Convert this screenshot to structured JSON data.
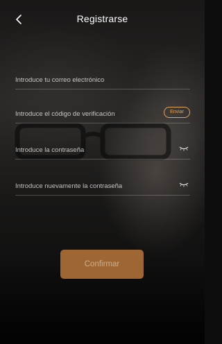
{
  "header": {
    "title": "Registrarse",
    "back_icon": "chevron-left-icon"
  },
  "form": {
    "email_placeholder": "Introduce tu correo electrónico",
    "code_placeholder": "Introduce el código de verificación",
    "send_label": "Enviar",
    "password_placeholder": "Introduce la contraseña",
    "confirm_password_placeholder": "Introduce nuevamente la contraseña",
    "eye_icon": "eye-closed-icon"
  },
  "actions": {
    "confirm_label": "Confirmar"
  },
  "colors": {
    "accent": "#e2a35e",
    "button_bg": "#b7763a",
    "text": "#ffffff"
  }
}
